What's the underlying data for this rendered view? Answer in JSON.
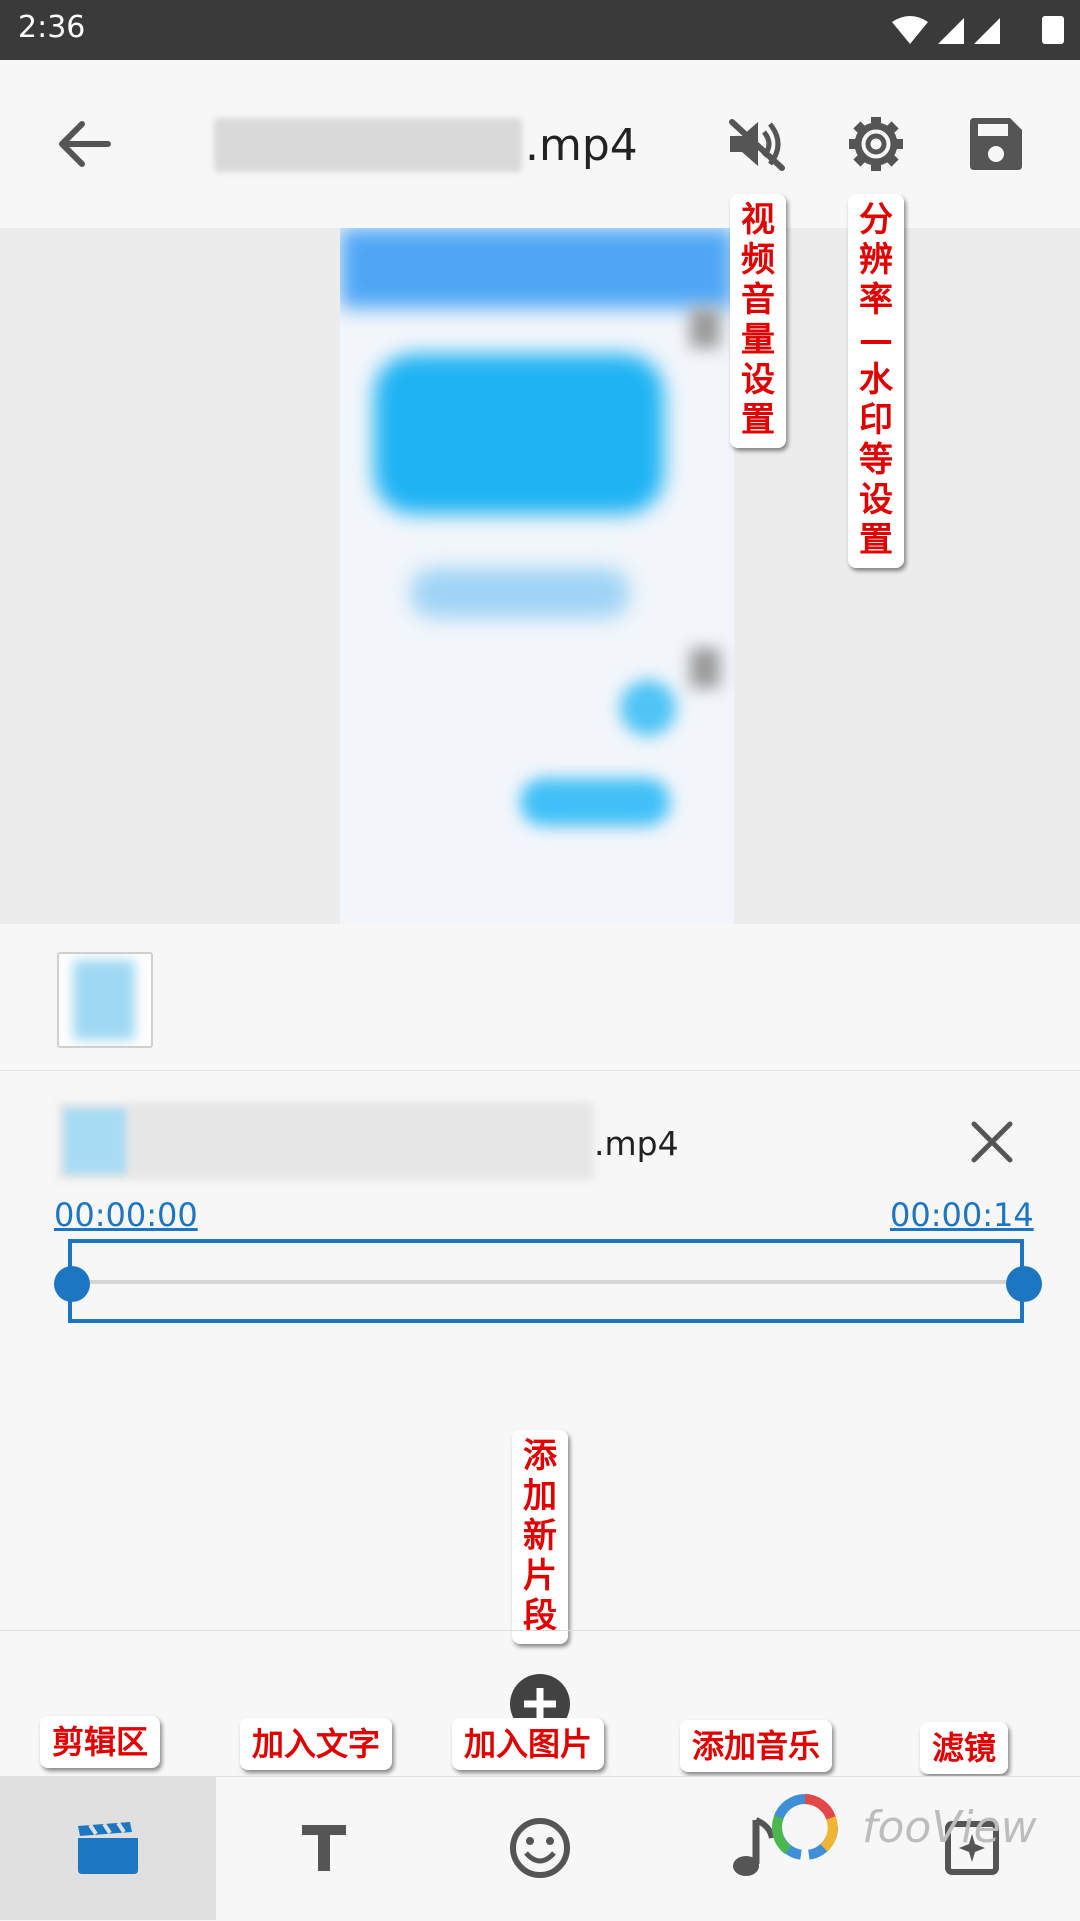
{
  "status_bar": {
    "time": "2:36"
  },
  "toolbar": {
    "title_extension": ".mp4",
    "back_icon": "arrow-back-icon",
    "volume_icon": "volume-off-icon",
    "settings_icon": "gear-icon",
    "save_icon": "save-icon"
  },
  "callouts": {
    "volume": "视频音量设置",
    "settings": "分辨率—水印等设置",
    "add_clip": "添加新片段",
    "edit": "剪辑区",
    "add_text": "加入文字",
    "add_image": "加入图片",
    "add_music": "添加音乐",
    "filter": "滤镜"
  },
  "clip_editor": {
    "file_extension": ".mp4",
    "start_time": "00:00:00",
    "end_time": "00:00:14",
    "trim_start_fraction": 0.0,
    "trim_end_fraction": 1.0
  },
  "bottom_nav": {
    "tabs": [
      {
        "icon": "clapperboard-icon",
        "active": true
      },
      {
        "icon": "text-icon",
        "active": false
      },
      {
        "icon": "emoji-icon",
        "active": false
      },
      {
        "icon": "music-note-icon",
        "active": false
      },
      {
        "icon": "filter-icon",
        "active": false
      }
    ]
  },
  "watermark": {
    "text": "fooView"
  },
  "colors": {
    "accent": "#1d76c2",
    "annotation_red": "#e00000",
    "statusbar": "#3a3a3a"
  }
}
